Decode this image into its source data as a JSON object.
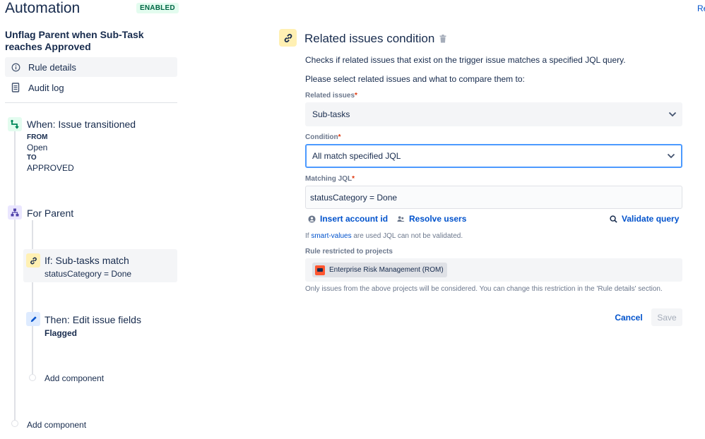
{
  "app": {
    "title": "Automation",
    "status_badge": "ENABLED",
    "top_right_link": "Re"
  },
  "rule": {
    "name": "Unflag Parent when Sub-Task reaches Approved"
  },
  "nav": {
    "items": [
      {
        "label": "Rule details",
        "icon": "info-icon",
        "active": true
      },
      {
        "label": "Audit log",
        "icon": "document-icon",
        "active": false
      }
    ]
  },
  "steps": {
    "trigger": {
      "title": "When: Issue transitioned",
      "from_label": "FROM",
      "from_value": "Open",
      "to_label": "TO",
      "to_value": "APPROVED",
      "icon": "transition-icon"
    },
    "branch": {
      "title": "For Parent",
      "icon": "hierarchy-icon"
    },
    "condition": {
      "title": "If: Sub-tasks match",
      "detail": "statusCategory = Done",
      "icon": "link-icon"
    },
    "action": {
      "title": "Then: Edit issue fields",
      "detail": "Flagged",
      "icon": "pencil-icon"
    },
    "add_inner": "Add component",
    "add_outer": "Add component"
  },
  "panel": {
    "title": "Related issues condition",
    "description": "Checks if related issues that exist on the trigger issue matches a specified JQL query.",
    "instruction": "Please select related issues and what to compare them to:",
    "related_issues": {
      "label": "Related issues",
      "required": "*",
      "value": "Sub-tasks"
    },
    "condition": {
      "label": "Condition",
      "required": "*",
      "value": "All match specified JQL"
    },
    "matching_jql": {
      "label": "Matching JQL",
      "required": "*",
      "value": "statusCategory = Done"
    },
    "actions": {
      "insert_account": "Insert account id",
      "resolve_users": "Resolve users",
      "validate": "Validate query"
    },
    "hint": {
      "prefix": "If",
      "link": "smart-values",
      "suffix": "are used JQL can not be validated."
    },
    "projects": {
      "label": "Rule restricted to projects",
      "chip": "Enterprise Risk Management (ROM)"
    },
    "projects_note": "Only issues from the above projects will be considered. You can change this restriction in the 'Rule details' section.",
    "buttons": {
      "cancel": "Cancel",
      "save": "Save"
    }
  },
  "colors": {
    "accent": "#0052cc",
    "badge_bg": "#e3fcef",
    "badge_text": "#006644",
    "condition_icon_bg": "#fff0b3",
    "focus_border": "#4c9aff",
    "required": "#de350b"
  }
}
